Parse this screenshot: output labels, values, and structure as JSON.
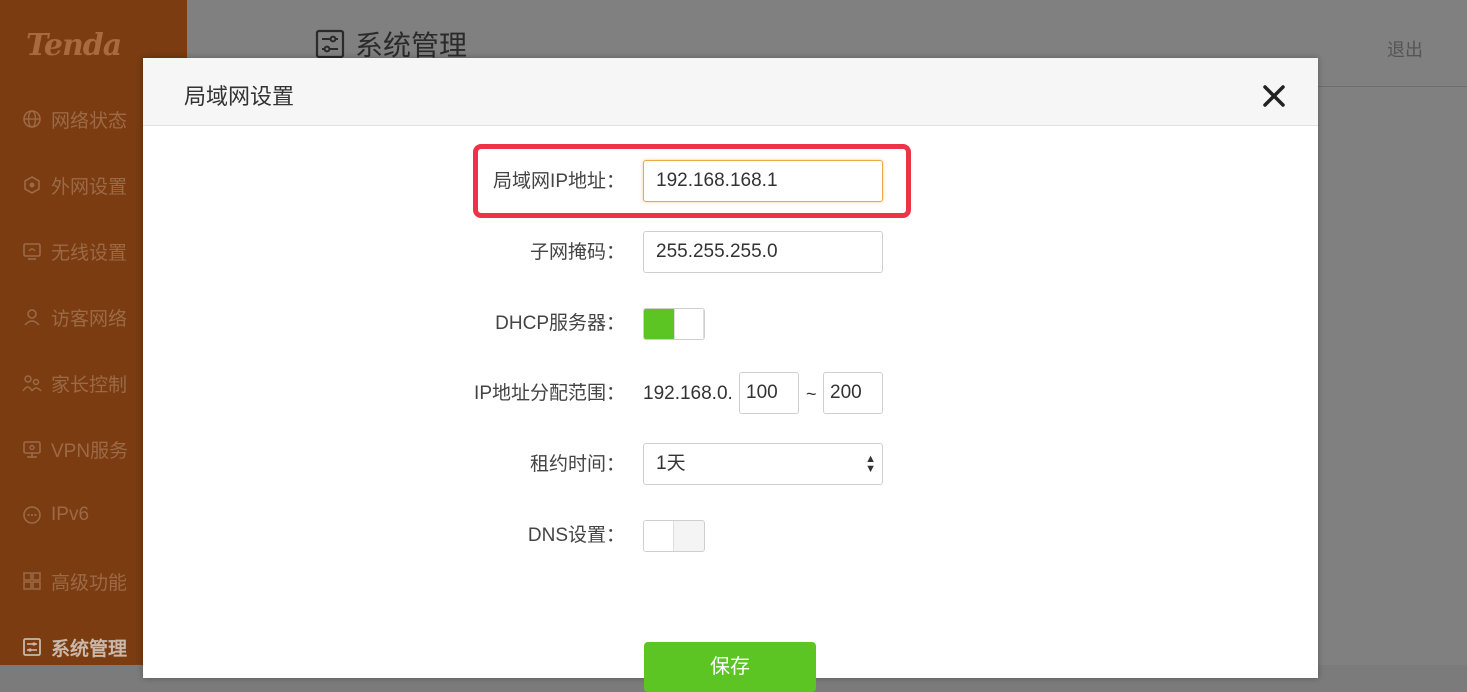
{
  "brand": "Tenda",
  "sidebar": {
    "items": [
      {
        "label": "网络状态",
        "icon": "globe-icon"
      },
      {
        "label": "外网设置",
        "icon": "wan-icon"
      },
      {
        "label": "无线设置",
        "icon": "wireless-icon"
      },
      {
        "label": "访客网络",
        "icon": "guest-icon"
      },
      {
        "label": "家长控制",
        "icon": "parental-icon"
      },
      {
        "label": "VPN服务",
        "icon": "vpn-icon"
      },
      {
        "label": "IPv6",
        "icon": "ipv6-icon"
      },
      {
        "label": "高级功能",
        "icon": "advanced-icon"
      },
      {
        "label": "系统管理",
        "icon": "system-icon",
        "active": true
      }
    ]
  },
  "header": {
    "title": "系统管理",
    "logout": "退出"
  },
  "modal": {
    "title": "局域网设置",
    "lan_ip": {
      "label": "局域网IP地址：",
      "value": "192.168.168.1"
    },
    "subnet": {
      "label": "子网掩码：",
      "value": "255.255.255.0"
    },
    "dhcp": {
      "label": "DHCP服务器：",
      "enabled": true
    },
    "ip_range": {
      "label": "IP地址分配范围：",
      "prefix": "192.168.0.",
      "start": "100",
      "separator": "~",
      "end": "200"
    },
    "lease": {
      "label": "租约时间：",
      "value": "1天"
    },
    "dns": {
      "label": "DNS设置：",
      "enabled": false
    },
    "save_label": "保存"
  },
  "colors": {
    "sidebar_bg": "#7a3c10",
    "accent_green": "#5cc524",
    "highlight_red": "#ee3248",
    "focus_orange": "#f0a64a"
  }
}
